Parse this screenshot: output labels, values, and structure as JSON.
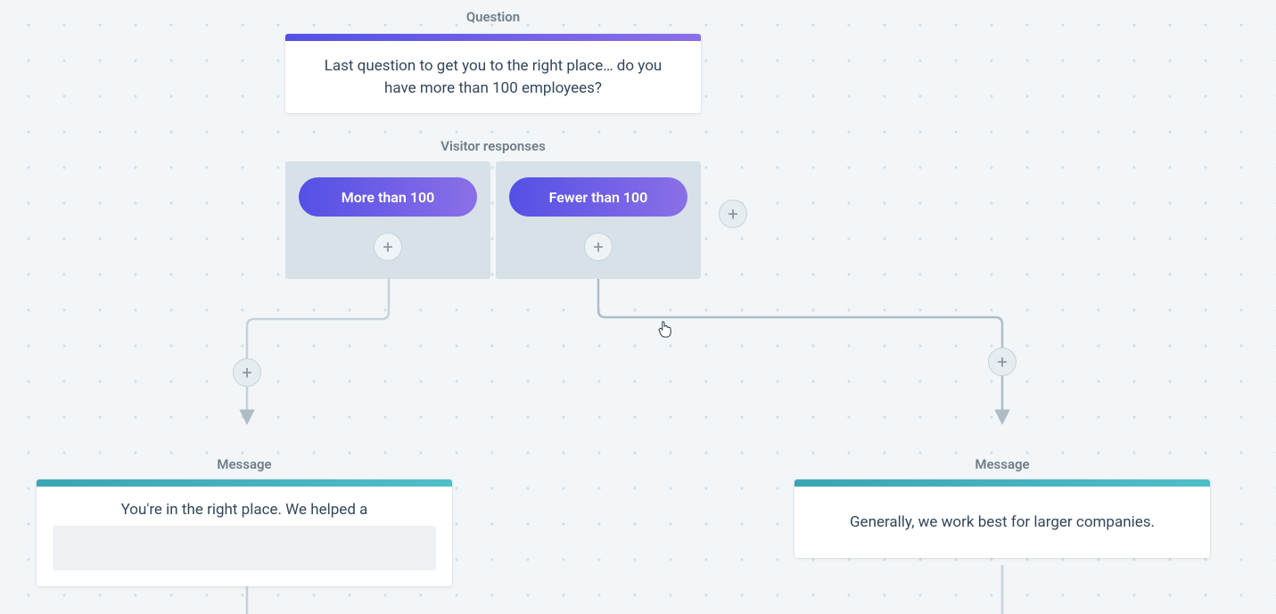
{
  "questionNode": {
    "label": "Question",
    "text": "Last question to get you to the right place… do you have more than 100 employees?"
  },
  "responses": {
    "label": "Visitor responses",
    "options": [
      {
        "label": "More than 100"
      },
      {
        "label": "Fewer than 100"
      }
    ]
  },
  "messageLeft": {
    "label": "Message",
    "text": "You're in the right place. We helped a "
  },
  "messageRight": {
    "label": "Message",
    "text": "Generally, we work best for larger companies."
  },
  "colors": {
    "purpleGradientStart": "#5450e5",
    "purpleGradientEnd": "#8b6fe7",
    "tealGradientStart": "#3ba4b5",
    "tealGradientEnd": "#4fbecb",
    "canvasBg": "#f3f6f8",
    "dot": "#d3dde3",
    "labelText": "#6f7d88",
    "bodyText": "#33475b",
    "responseBg": "#d6e2e8"
  }
}
